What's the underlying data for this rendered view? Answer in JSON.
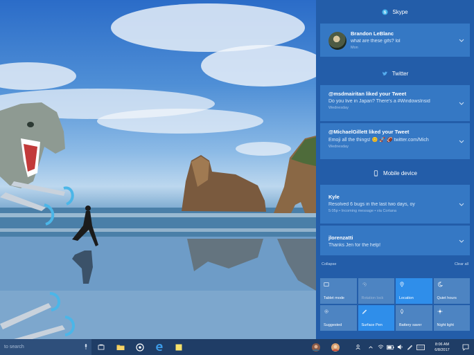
{
  "taskbar": {
    "search_placeholder": "to search",
    "clock_time": "8:06 AM",
    "clock_date": "6/8/2017"
  },
  "action_center": {
    "groups": {
      "skype": {
        "name": "Skype",
        "notification": {
          "title": "Brandon LeBlanc",
          "body": "what are these gifs? lol",
          "meta": "Mon"
        }
      },
      "twitter": {
        "name": "Twitter",
        "notifications": [
          {
            "title": "@msdmairitan liked your Tweet",
            "body": "Do you live in Japan? There's a #WindowsInsid",
            "meta": "Wednesday"
          },
          {
            "title": "@MichaelGillett liked your Tweet",
            "body": "Emoji all the things! 😊 🚀 🏈 twitter.com/Mich",
            "meta": "Wednesday"
          }
        ]
      },
      "mobile": {
        "name": "Mobile device",
        "notifications": [
          {
            "title": "Kyle",
            "body": "Resolved 6 bugs in the last two days, oy",
            "meta": "5:05p • Incoming message • via Cortana"
          },
          {
            "title": "jlorenzatti",
            "body": "Thanks Jen for the help!",
            "meta": ""
          }
        ]
      }
    },
    "collapse_label": "Collapse",
    "clear_all_label": "Clear all",
    "quick_actions": [
      {
        "label": "Tablet mode",
        "icon": "tablet-icon",
        "state": "off"
      },
      {
        "label": "Rotation lock",
        "icon": "rotation-lock-icon",
        "state": "disabled"
      },
      {
        "label": "Location",
        "icon": "location-icon",
        "state": "on"
      },
      {
        "label": "Quiet hours",
        "icon": "moon-icon",
        "state": "off"
      },
      {
        "label": "Suggested",
        "icon": "settings-icon",
        "state": "off"
      },
      {
        "label": "Surface Pen",
        "icon": "pen-icon",
        "state": "on"
      },
      {
        "label": "Battery saver",
        "icon": "battery-saver-icon",
        "state": "off"
      },
      {
        "label": "Night light",
        "icon": "night-light-icon",
        "state": "off"
      }
    ]
  },
  "colors": {
    "action_center_bg": "#225ca8",
    "tile_active": "#2f8eea",
    "taskbar_bg": "#1f3d66"
  }
}
